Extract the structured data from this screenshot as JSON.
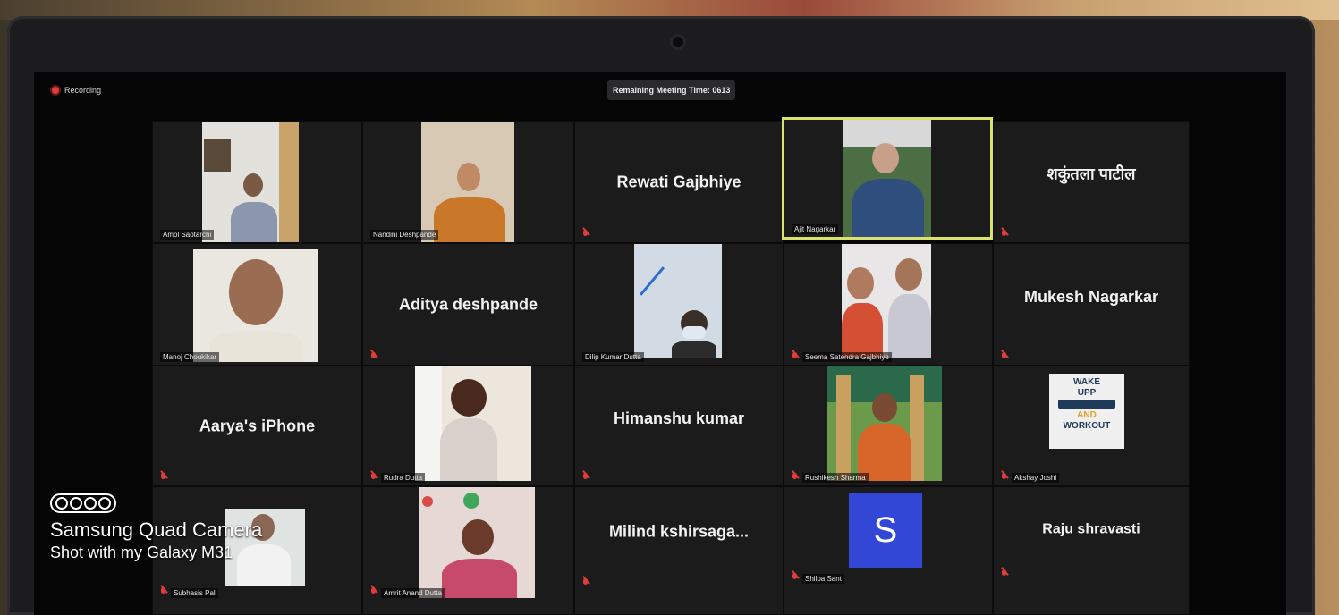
{
  "meeting": {
    "recording_label": "Recording",
    "timer_label": "Remaining Meeting Time: 0613"
  },
  "participants": [
    {
      "name": "Amol Saotarchi",
      "big": ""
    },
    {
      "name": "Nandini Deshpande",
      "big": ""
    },
    {
      "name": "",
      "big": "Rewati Gajbhiye"
    },
    {
      "name": "Ajit Nagarkar",
      "big": ""
    },
    {
      "name": "",
      "big": "शकुंतला पाटील"
    },
    {
      "name": "Manoj Choukikar",
      "big": ""
    },
    {
      "name": "",
      "big": "Aditya deshpande"
    },
    {
      "name": "Dilip Kumar Dutta",
      "big": ""
    },
    {
      "name": "Seema Satendra Gajbhiye",
      "big": ""
    },
    {
      "name": "",
      "big": "Mukesh Nagarkar"
    },
    {
      "name": "",
      "big": "Aarya's iPhone"
    },
    {
      "name": "Rudra Dutta",
      "big": ""
    },
    {
      "name": "",
      "big": "Himanshu kumar"
    },
    {
      "name": "Rushikesh Sharma",
      "big": ""
    },
    {
      "name": "Akshay Joshi",
      "big": ""
    },
    {
      "name": "Subhasis Pal",
      "big": ""
    },
    {
      "name": "Amrit Anand Dutta",
      "big": ""
    },
    {
      "name": "",
      "big": "Milind  kshirsaga..."
    },
    {
      "name": "Shilpa Sant",
      "big": ""
    },
    {
      "name": "",
      "big": "Raju shravasti"
    }
  ],
  "avatar_letter": "S",
  "logo_text": {
    "line1": "WAKE",
    "line2": "UPP",
    "line3": "AND",
    "line4": "WORKOUT"
  },
  "watermark": {
    "title": "Samsung Quad Camera",
    "subtitle": "Shot with my Galaxy M31"
  },
  "colors": {
    "active_border": "#d7e36a",
    "mic_muted": "#e23b3b",
    "avatar_bg": "#3347d6"
  }
}
